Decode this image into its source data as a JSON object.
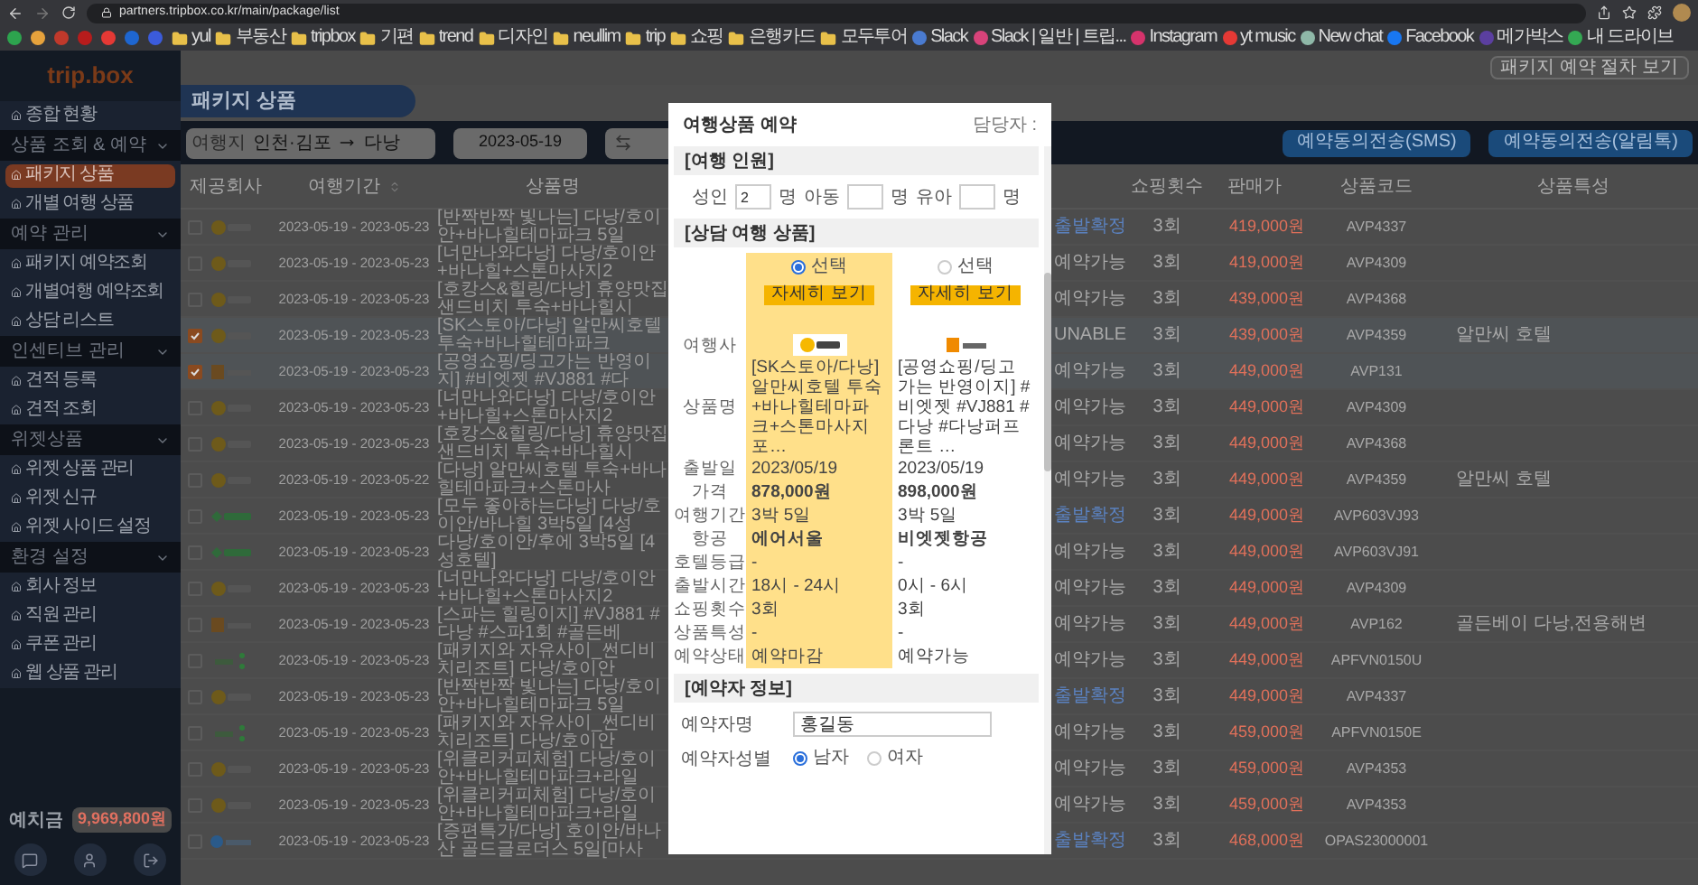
{
  "browser": {
    "url": "partners.tripbox.co.kr/main/package/list",
    "bookmarks": [
      {
        "label": "yul",
        "kind": "folder"
      },
      {
        "label": "부동산",
        "kind": "folder"
      },
      {
        "label": "tripbox",
        "kind": "folder"
      },
      {
        "label": "기편",
        "kind": "folder"
      },
      {
        "label": "trend",
        "kind": "folder"
      },
      {
        "label": "디자인",
        "kind": "folder"
      },
      {
        "label": "neullim",
        "kind": "folder"
      },
      {
        "label": "trip",
        "kind": "folder"
      },
      {
        "label": "쇼핑",
        "kind": "folder"
      },
      {
        "label": "은행카드",
        "kind": "folder"
      },
      {
        "label": "모두투어",
        "kind": "folder"
      },
      {
        "label": "Slack",
        "kind": "app"
      },
      {
        "label": "Slack | 일반 | 트립...",
        "kind": "slack"
      },
      {
        "label": "Instagram",
        "kind": "instagram"
      },
      {
        "label": "yt music",
        "kind": "music"
      },
      {
        "label": "New chat",
        "kind": "chat"
      },
      {
        "label": "Facebook",
        "kind": "facebook"
      },
      {
        "label": "메가박스",
        "kind": "mega"
      },
      {
        "label": "내 드라이브",
        "kind": "drive"
      }
    ]
  },
  "sidebar": {
    "logo": "trip.box",
    "items": [
      {
        "kind": "item",
        "label": "종합 현황",
        "selected": false
      },
      {
        "kind": "section",
        "label": "상품 조회 & 예약"
      },
      {
        "kind": "item",
        "label": "패키지 상품",
        "selected": true
      },
      {
        "kind": "item",
        "label": "개별 여행 상품",
        "selected": false
      },
      {
        "kind": "section",
        "label": "예약 관리"
      },
      {
        "kind": "item",
        "label": "패키지 예약조회",
        "selected": false
      },
      {
        "kind": "item",
        "label": "개별여행 예약조회",
        "selected": false
      },
      {
        "kind": "item",
        "label": "상담 리스트",
        "selected": false
      },
      {
        "kind": "section",
        "label": "인센티브 관리"
      },
      {
        "kind": "item",
        "label": "견적 등록",
        "selected": false
      },
      {
        "kind": "item",
        "label": "견적 조회",
        "selected": false
      },
      {
        "kind": "section",
        "label": "위젯상품"
      },
      {
        "kind": "item",
        "label": "위젯 상품 관리",
        "selected": false
      },
      {
        "kind": "item",
        "label": "위젯 신규",
        "selected": false
      },
      {
        "kind": "item",
        "label": "위젯 사이드 설정",
        "selected": false
      },
      {
        "kind": "section",
        "label": "환경 설정"
      },
      {
        "kind": "item",
        "label": "회사 정보",
        "selected": false
      },
      {
        "kind": "item",
        "label": "직원 관리",
        "selected": false
      },
      {
        "kind": "item",
        "label": "쿠폰 관리",
        "selected": false
      },
      {
        "kind": "item",
        "label": "웹 상품 관리",
        "selected": false
      }
    ],
    "deposit": {
      "label": "예치금",
      "amount": "9,969,800원"
    }
  },
  "page": {
    "title": "패키지 상품",
    "guide_button": "패키지 예약 절차 보기"
  },
  "search": {
    "label": "여행지",
    "from": "인천·김포",
    "to": "다낭",
    "date": "2023-05-19",
    "buttons": [
      "예약동의전송(SMS)",
      "예약동의전송(알림톡)"
    ]
  },
  "table": {
    "columns": [
      "제공회사",
      "여행기간",
      "상품명",
      "쇼핑횟수",
      "판매가",
      "상품코드",
      "상품특성"
    ],
    "rows": [
      {
        "selected": false,
        "company": {
          "kind": "balloon"
        },
        "period": "2023-05-19 - 2023-05-23",
        "name": "[반짝반짝 빛나는] 다낭/호이안+바나힐테마파크 5일",
        "status": {
          "text": "출발확정",
          "color": "#5b82c0"
        },
        "shopping": "3회",
        "price": "419,000원",
        "code": "AVP4337"
      },
      {
        "selected": false,
        "company": {
          "kind": "balloon"
        },
        "period": "2023-05-19 - 2023-05-23",
        "name": "[너만나와다낭] 다낭/호이안+바나힐+스톤마사지2",
        "status": {
          "text": "예약가능",
          "color": "#a8a8a8"
        },
        "shopping": "3회",
        "price": "419,000원",
        "code": "AVP4309"
      },
      {
        "selected": false,
        "company": {
          "kind": "balloon"
        },
        "period": "2023-05-19 - 2023-05-23",
        "name": "[호캉스&힐링/다낭] 휴양맛집 샌드비치 투숙+바나힐시",
        "status": {
          "text": "예약가능",
          "color": "#a8a8a8"
        },
        "shopping": "3회",
        "price": "439,000원",
        "code": "AVP4368"
      },
      {
        "selected": true,
        "company": {
          "kind": "balloon"
        },
        "period": "2023-05-19 - 2023-05-23",
        "name": "[SK스토아/다낭] 알만씨호텔 투숙+바나힐테마파크",
        "status": {
          "text": "UNABLE",
          "color": "#a8a8a8"
        },
        "shopping": "3회",
        "price": "439,000원",
        "code": "AVP4359",
        "feature": "알만씨 호텔"
      },
      {
        "selected": true,
        "company": {
          "kind": "gongyoung"
        },
        "period": "2023-05-19 - 2023-05-23",
        "name": "[공영쇼핑/딩고가는 반영이지] #비엣젯 #VJ881 #다",
        "status": {
          "text": "예약가능",
          "color": "#a8a8a8"
        },
        "shopping": "3회",
        "price": "449,000원",
        "code": "AVP131"
      },
      {
        "selected": false,
        "company": {
          "kind": "balloon"
        },
        "period": "2023-05-19 - 2023-05-23",
        "name": "[너만나와다낭] 다낭/호이안+바나힐+스톤마사지2",
        "status": {
          "text": "예약가능",
          "color": "#a8a8a8"
        },
        "shopping": "3회",
        "price": "449,000원",
        "code": "AVP4309"
      },
      {
        "selected": false,
        "company": {
          "kind": "balloon"
        },
        "period": "2023-05-19 - 2023-05-23",
        "name": "[호캉스&힐링/다낭] 휴양맛집 샌드비치 투숙+바나힐시",
        "status": {
          "text": "예약가능",
          "color": "#a8a8a8"
        },
        "shopping": "3회",
        "price": "449,000원",
        "code": "AVP4368"
      },
      {
        "selected": false,
        "company": {
          "kind": "balloon"
        },
        "period": "2023-05-19 - 2023-05-22",
        "name": "[다낭] 알만씨호텔 투숙+바나힐테마파크+스톤마사",
        "status": {
          "text": "예약가능",
          "color": "#a8a8a8"
        },
        "shopping": "3회",
        "price": "449,000원",
        "code": "AVP4359",
        "feature": "알만씨 호텔"
      },
      {
        "selected": false,
        "company": {
          "kind": "modetour"
        },
        "period": "2023-05-19 - 2023-05-23",
        "name": "[모두 좋아하는다낭] 다낭/호이안/바나힐 3박5일 [4성",
        "status": {
          "text": "출발확정",
          "color": "#5b82c0"
        },
        "shopping": "3회",
        "price": "449,000원",
        "code": "AVP603VJ93"
      },
      {
        "selected": false,
        "company": {
          "kind": "modetour"
        },
        "period": "2023-05-19 - 2023-05-23",
        "name": "다낭/호이안/후에 3박5일 [4성호텔]",
        "status": {
          "text": "예약가능",
          "color": "#a8a8a8"
        },
        "shopping": "3회",
        "price": "449,000원",
        "code": "AVP603VJ91"
      },
      {
        "selected": false,
        "company": {
          "kind": "balloon"
        },
        "period": "2023-05-19 - 2023-05-23",
        "name": "[너만나와다낭] 다낭/호이안+바나힐+스톤마사지2",
        "status": {
          "text": "예약가능",
          "color": "#a8a8a8"
        },
        "shopping": "3회",
        "price": "449,000원",
        "code": "AVP4309"
      },
      {
        "selected": false,
        "company": {
          "kind": "gongyoung"
        },
        "period": "2023-05-19 - 2023-05-23",
        "name": "[스파는 힐링이지] #VJ881 #다낭 #스파1회 #골든베",
        "status": {
          "text": "예약가능",
          "color": "#a8a8a8"
        },
        "shopping": "3회",
        "price": "449,000원",
        "code": "AVP162",
        "feature": "골든베이 다낭,전용해변"
      },
      {
        "selected": false,
        "company": {
          "kind": "green"
        },
        "period": "2023-05-19 - 2023-05-23",
        "name": "[패키지와 자유사이_썬디비치리조트] 다낭/호이안",
        "status": {
          "text": "예약가능",
          "color": "#a8a8a8"
        },
        "shopping": "3회",
        "price": "449,000원",
        "code": "APFVN0150U"
      },
      {
        "selected": false,
        "company": {
          "kind": "balloon"
        },
        "period": "2023-05-19 - 2023-05-23",
        "name": "[반짝반짝 빛나는] 다낭/호이안+바나힐테마파크 5일",
        "status": {
          "text": "출발확정",
          "color": "#5b82c0"
        },
        "shopping": "3회",
        "price": "449,000원",
        "code": "AVP4337"
      },
      {
        "selected": false,
        "company": {
          "kind": "green"
        },
        "period": "2023-05-19 - 2023-05-23",
        "name": "[패키지와 자유사이_썬디비치리조트] 다낭/호이안",
        "status": {
          "text": "예약가능",
          "color": "#a8a8a8"
        },
        "shopping": "3회",
        "price": "459,000원",
        "code": "APFVN0150E"
      },
      {
        "selected": false,
        "company": {
          "kind": "balloon"
        },
        "period": "2023-05-19 - 2023-05-23",
        "name": "[위클리커피체험] 다낭/호이안+바나힐테마파크+라일",
        "status": {
          "text": "예약가능",
          "color": "#a8a8a8"
        },
        "shopping": "3회",
        "price": "459,000원",
        "code": "AVP4353"
      },
      {
        "selected": false,
        "company": {
          "kind": "balloon"
        },
        "period": "2023-05-19 - 2023-05-23",
        "name": "[위클리커피체험] 다낭/호이안+바나힐테마파크+라일",
        "status": {
          "text": "예약가능",
          "color": "#a8a8a8"
        },
        "shopping": "3회",
        "price": "459,000원",
        "code": "AVP4353"
      },
      {
        "selected": false,
        "company": {
          "kind": "blue"
        },
        "period": "2023-05-19 - 2023-05-23",
        "name": "[증편특가/다낭] 호이안/바나산 골드글로더스 5일[마사",
        "status": {
          "text": "출발확정",
          "color": "#5b82c0"
        },
        "shopping": "3회",
        "price": "468,000원",
        "code": "OPAS23000001"
      }
    ]
  },
  "modal": {
    "title": "여행상품 예약",
    "manager_label": "담당자 :",
    "party": {
      "title": "[여행 인원]",
      "fields": [
        {
          "label": "성인",
          "value": "2",
          "unit": "명"
        },
        {
          "label": "아동",
          "unit": "명"
        },
        {
          "label": "유아",
          "unit": "명"
        }
      ]
    },
    "compare": {
      "title": "[상담 여행 상품]",
      "company_label": "여행사",
      "row_labels": [
        "상품명",
        "출발일",
        "가격",
        "여행기간",
        "항공",
        "호텔등급",
        "출발시간",
        "쇼핑횟수",
        "상품특성",
        "예약상태"
      ],
      "options": [
        {
          "radio_label": "선택",
          "selected": true,
          "detail_button": "자세히 보기",
          "company": {
            "kind": "balloon"
          },
          "values": [
            "[SK스토아/다낭] 알만씨호텔 투숙+바나힐테마파크+스톤마사지 포…",
            "2023/05/19",
            "878,000원",
            "3박 5일",
            "에어서울",
            "-",
            "18시 - 24시",
            "3회",
            "-",
            "예약마감"
          ]
        },
        {
          "radio_label": "선택",
          "selected": false,
          "detail_button": "자세히 보기",
          "company": {
            "kind": "gongyoung"
          },
          "values": [
            "[공영쇼핑/딩고가는 반영이지] #비엣젯 #VJ881 #다낭 #다낭퍼프론트 …",
            "2023/05/19",
            "898,000원",
            "3박 5일",
            "비엣젯항공",
            "-",
            "0시 - 6시",
            "3회",
            "-",
            "예약가능"
          ]
        }
      ]
    },
    "booker": {
      "title": "[예약자 정보]",
      "name_label": "예약자명",
      "name_value": "홍길동",
      "gender_label": "예약자성별",
      "genders": [
        {
          "label": "남자",
          "selected": true
        },
        {
          "label": "여자",
          "selected": false
        }
      ]
    }
  }
}
